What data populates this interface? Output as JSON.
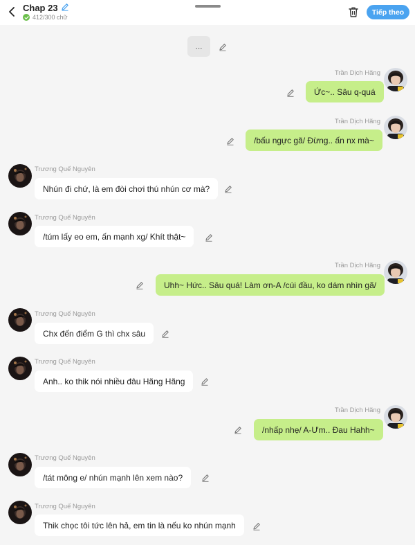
{
  "header": {
    "title": "Chap 23",
    "word_count": "412/300 chữ",
    "next_label": "Tiếp theo",
    "icons": [
      "back-arrow-icon",
      "edit-pencil-icon",
      "check-icon",
      "trash-icon"
    ],
    "accent_color": "#4aa3f0"
  },
  "placeholder_bubble": "...",
  "messages": [
    {
      "side": "right",
      "author": "Trần Dịch Hãng",
      "text": "Ức~.. Sâu q-quá"
    },
    {
      "side": "right",
      "author": "Trần Dịch Hãng",
      "text": "/bấu ngực gã/ Đừng.. ấn nx mà~"
    },
    {
      "side": "left",
      "author": "Trương Quế Nguyên",
      "text": "Nhún đi chứ, là em đòi chơi thú nhún cơ mà?"
    },
    {
      "side": "left",
      "author": "Trương Quế Nguyên",
      "text": "/túm lấy eo em, ấn mạnh xg/ Khít thật~"
    },
    {
      "side": "right",
      "author": "Trần Dịch Hãng",
      "text": "Uhh~ Hức.. Sâu quá! Làm ơn-A /cúi đầu, ko dám nhìn gã/"
    },
    {
      "side": "left",
      "author": "Trương Quế Nguyên",
      "text": "Chx đến điểm G thì chx sâu"
    },
    {
      "side": "left",
      "author": "Trương Quế Nguyên",
      "text": "Anh.. ko thik nói nhiều đâu Hãng Hãng"
    },
    {
      "side": "right",
      "author": "Trần Dịch Hãng",
      "text": "/nhấp nhẹ/ A-Ưm.. Đau Hahh~"
    },
    {
      "side": "left",
      "author": "Trương Quế Nguyên",
      "text": "/tát mông e/ nhún mạnh lên xem nào?"
    },
    {
      "side": "left",
      "author": "Trương Quế Nguyên",
      "text": "Thik chọc tôi tức lên hả, em tin là nếu ko nhún mạnh"
    }
  ],
  "colors": {
    "outgoing_bubble": "#c6ee8a",
    "incoming_bubble": "#ffffff",
    "background": "#f5f5f5"
  }
}
